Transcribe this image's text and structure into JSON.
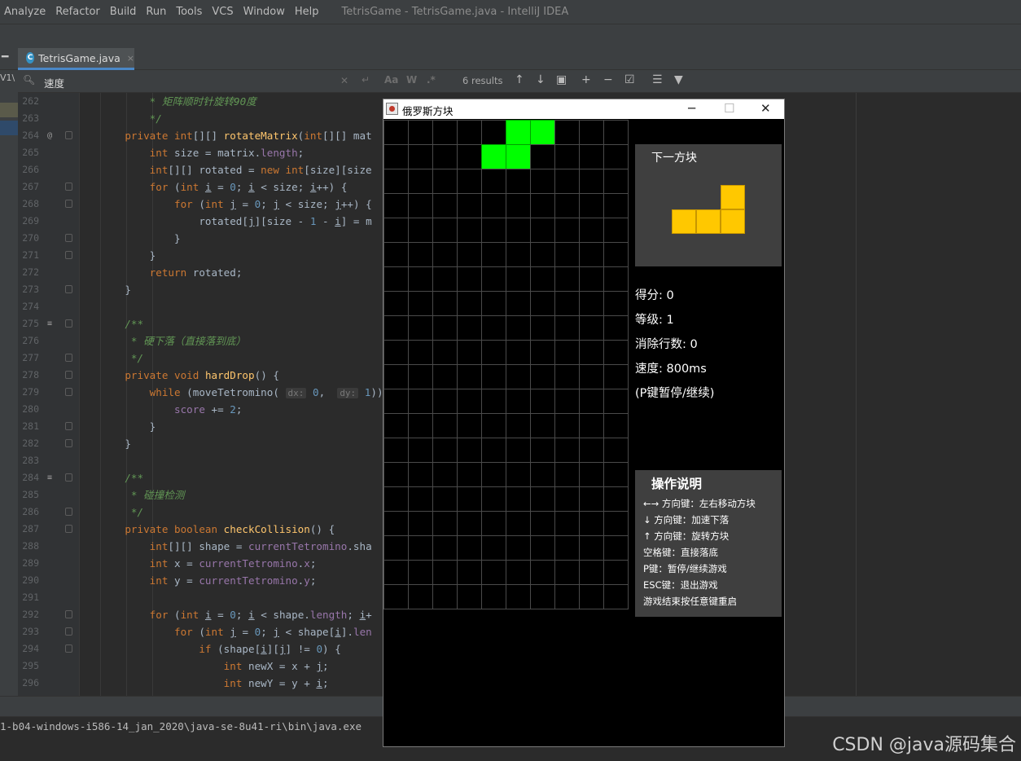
{
  "menu": {
    "items": [
      "Analyze",
      "Refactor",
      "Build",
      "Run",
      "Tools",
      "VCS",
      "Window",
      "Help"
    ],
    "window_title": "TetrisGame - TetrisGame.java - IntelliJ IDEA"
  },
  "editor_tab": {
    "label": "TetrisGame.java",
    "close": "×",
    "icon": "class-icon"
  },
  "left_strip": {
    "label": "V1\\"
  },
  "find": {
    "query": "速度",
    "results": "6 results",
    "match_case": "Aa",
    "words": "W",
    "regex": ".*"
  },
  "code": {
    "lines": [
      {
        "n": "262",
        "html": "        <span class=\"c\">* 矩阵顺时针旋转90度</span>"
      },
      {
        "n": "263",
        "html": "        <span class=\"c\">*/</span>"
      },
      {
        "n": "264",
        "html": "    <span class=\"k\">private int</span>[][] <span class=\"f\">rotateMatrix</span>(<span class=\"k\">int</span>[][] mat"
      },
      {
        "n": "265",
        "html": "        <span class=\"k\">int</span> size = matrix.<span class=\"fld\">length</span>;"
      },
      {
        "n": "266",
        "html": "        <span class=\"k\">int</span>[][] rotated = <span class=\"k\">new int</span>[size][size"
      },
      {
        "n": "267",
        "html": "        <span class=\"k\">for</span> (<span class=\"k\">int</span> <span class=\"ul\">i</span> = <span class=\"n\">0</span>; <span class=\"ul\">i</span> &lt; size; <span class=\"ul\">i</span>++) {"
      },
      {
        "n": "268",
        "html": "            <span class=\"k\">for</span> (<span class=\"k\">int</span> <span class=\"ul\">j</span> = <span class=\"n\">0</span>; <span class=\"ul\">j</span> &lt; size; <span class=\"ul\">j</span>++) {"
      },
      {
        "n": "269",
        "html": "                rotated[<span class=\"ul\">j</span>][size - <span class=\"n\">1</span> - <span class=\"ul\">i</span>] = m"
      },
      {
        "n": "270",
        "html": "            }"
      },
      {
        "n": "271",
        "html": "        }"
      },
      {
        "n": "272",
        "html": "        <span class=\"k\">return</span> rotated;"
      },
      {
        "n": "273",
        "html": "    }"
      },
      {
        "n": "274",
        "html": ""
      },
      {
        "n": "275",
        "html": "    <span class=\"c\">/**</span>"
      },
      {
        "n": "276",
        "html": "     <span class=\"c\">* 硬下落（直接落到底）</span>"
      },
      {
        "n": "277",
        "html": "     <span class=\"c\">*/</span>"
      },
      {
        "n": "278",
        "html": "    <span class=\"k\">private void</span> <span class=\"f\">hardDrop</span>() {"
      },
      {
        "n": "279",
        "html": "        <span class=\"k\">while</span> (moveTetromino( <span class=\"h\">dx:</span> <span class=\"n\">0</span>,  <span class=\"h\">dy:</span> <span class=\"n\">1</span>))"
      },
      {
        "n": "280",
        "html": "            <span class=\"fld\">score</span> += <span class=\"n\">2</span>;"
      },
      {
        "n": "281",
        "html": "        }"
      },
      {
        "n": "282",
        "html": "    }"
      },
      {
        "n": "283",
        "html": ""
      },
      {
        "n": "284",
        "html": "    <span class=\"c\">/**</span>"
      },
      {
        "n": "285",
        "html": "     <span class=\"c\">* 碰撞检测</span>"
      },
      {
        "n": "286",
        "html": "     <span class=\"c\">*/</span>"
      },
      {
        "n": "287",
        "html": "    <span class=\"k\">private boolean</span> <span class=\"f\">checkCollision</span>() {"
      },
      {
        "n": "288",
        "html": "        <span class=\"k\">int</span>[][] shape = <span class=\"fld\">currentTetromino</span>.sha"
      },
      {
        "n": "289",
        "html": "        <span class=\"k\">int</span> x = <span class=\"fld\">currentTetromino</span>.<span class=\"fld\">x</span>;"
      },
      {
        "n": "290",
        "html": "        <span class=\"k\">int</span> y = <span class=\"fld\">currentTetromino</span>.<span class=\"fld\">y</span>;"
      },
      {
        "n": "291",
        "html": ""
      },
      {
        "n": "292",
        "html": "        <span class=\"k\">for</span> (<span class=\"k\">int</span> <span class=\"ul\">i</span> = <span class=\"n\">0</span>; <span class=\"ul\">i</span> &lt; shape.<span class=\"fld\">length</span>; <span class=\"ul\">i</span>+"
      },
      {
        "n": "293",
        "html": "            <span class=\"k\">for</span> (<span class=\"k\">int</span> <span class=\"ul\">j</span> = <span class=\"n\">0</span>; <span class=\"ul\">j</span> &lt; shape[<span class=\"ul\">i</span>].<span class=\"fld\">len</span>"
      },
      {
        "n": "294",
        "html": "                <span class=\"k\">if</span> (shape[<span class=\"ul\">i</span>][<span class=\"ul\">j</span>] != <span class=\"n\">0</span>) {"
      },
      {
        "n": "295",
        "html": "                    <span class=\"k\">int</span> newX = x + <span class=\"ul\">j</span>;"
      },
      {
        "n": "296",
        "html": "                    <span class=\"k\">int</span> newY = y + <span class=\"ul\">i</span>;"
      }
    ]
  },
  "console": {
    "line": "1-b04-windows-i586-14_jan_2020\\java-se-8u41-ri\\bin\\java.exe"
  },
  "watermark": "CSDN @java源码集合",
  "tetris": {
    "window_title": "俄罗斯方块",
    "minimize": "─",
    "maximize": "☐",
    "close": "✕",
    "board_cols": 10,
    "board_rows": 20,
    "active_color": "#00ff00",
    "active_cells": [
      [
        5,
        0
      ],
      [
        6,
        0
      ],
      [
        4,
        1
      ],
      [
        5,
        1
      ]
    ],
    "next_label": "下一方块",
    "next_color": "#ffc800",
    "next_cells": [
      [
        2,
        0
      ],
      [
        0,
        1
      ],
      [
        1,
        1
      ],
      [
        2,
        1
      ]
    ],
    "score": "得分: 0",
    "level": "等级: 1",
    "lines": "消除行数: 0",
    "speed": "速度: 800ms",
    "pause_hint": "(P键暂停/继续)",
    "help_title": "操作说明",
    "help_lines": [
      "←→ 方向键：左右移动方块",
      "↓ 方向键：加速下落",
      "↑ 方向键：旋转方块",
      "空格键：直接落底",
      "P键：暂停/继续游戏",
      "ESC键：退出游戏",
      "游戏结束按任意键重启"
    ]
  }
}
